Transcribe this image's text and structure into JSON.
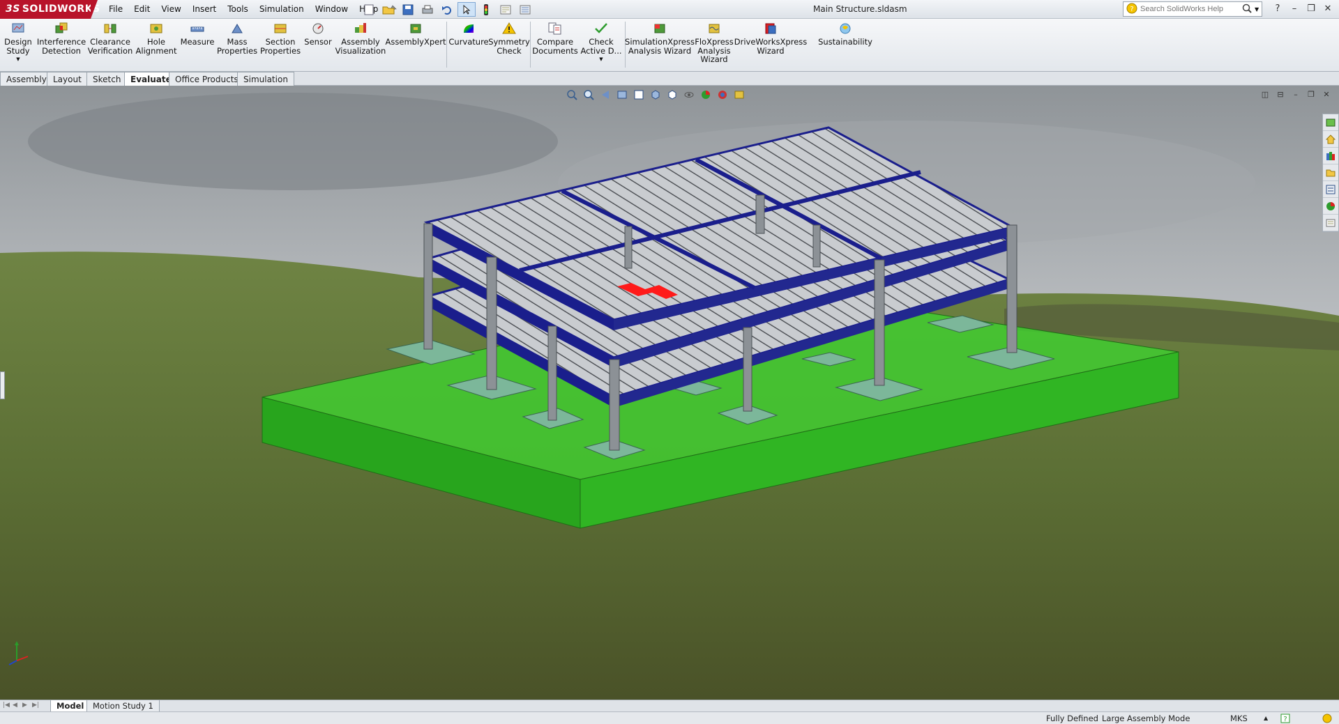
{
  "app": {
    "brand": "SOLIDWORKS",
    "brand_prefix": "3S",
    "document_title": "Main Structure.sldasm"
  },
  "menu": [
    "File",
    "Edit",
    "View",
    "Insert",
    "Tools",
    "Simulation",
    "Window",
    "Help"
  ],
  "search": {
    "placeholder": "Search SolidWorks Help"
  },
  "commands": [
    {
      "label1": "Design",
      "label2": "Study",
      "icon": "design-study-icon"
    },
    {
      "label1": "Interference",
      "label2": "Detection",
      "icon": "interference-detection-icon"
    },
    {
      "label1": "Clearance",
      "label2": "Verification",
      "icon": "clearance-verification-icon"
    },
    {
      "label1": "Hole",
      "label2": "Alignment",
      "icon": "hole-alignment-icon"
    },
    {
      "label1": "Measure",
      "label2": "",
      "icon": "measure-icon"
    },
    {
      "label1": "Mass",
      "label2": "Properties",
      "icon": "mass-properties-icon"
    },
    {
      "label1": "Section",
      "label2": "Properties",
      "icon": "section-properties-icon"
    },
    {
      "label1": "Sensor",
      "label2": "",
      "icon": "sensor-icon"
    },
    {
      "label1": "Assembly",
      "label2": "Visualization",
      "icon": "assembly-visualization-icon"
    },
    {
      "label1": "AssemblyXpert",
      "label2": "",
      "icon": "assemblyxpert-icon"
    },
    {
      "label1": "Curvature",
      "label2": "",
      "icon": "curvature-icon"
    },
    {
      "label1": "Symmetry",
      "label2": "Check",
      "icon": "symmetry-check-icon"
    },
    {
      "label1": "Compare",
      "label2": "Documents",
      "icon": "compare-documents-icon"
    },
    {
      "label1": "Check",
      "label2": "Active D...",
      "icon": "check-active-doc-icon"
    },
    {
      "label1": "SimulationXpress",
      "label2": "Analysis Wizard",
      "icon": "simulationxpress-icon"
    },
    {
      "label1": "FloXpress",
      "label2": "Analysis",
      "label3": "Wizard",
      "icon": "floxpress-icon"
    },
    {
      "label1": "DriveWorksXpress",
      "label2": "Wizard",
      "icon": "driveworksxpress-icon"
    },
    {
      "label1": "Sustainability",
      "label2": "",
      "icon": "sustainability-icon"
    }
  ],
  "tabs": [
    "Assembly",
    "Layout",
    "Sketch",
    "Evaluate",
    "Office Products",
    "Simulation"
  ],
  "active_tab": "Evaluate",
  "bottom_tabs": [
    "Model",
    "Motion Study 1"
  ],
  "status": {
    "state": "Fully Defined",
    "mode": "Large Assembly Mode",
    "units": "MKS"
  },
  "colors": {
    "beam": "#1a1e8c",
    "column": "#8c9196",
    "deck": "#c9ccd0",
    "ground_box": "#35c025",
    "highlight": "#ff1a1a",
    "brand": "#b8132a"
  }
}
